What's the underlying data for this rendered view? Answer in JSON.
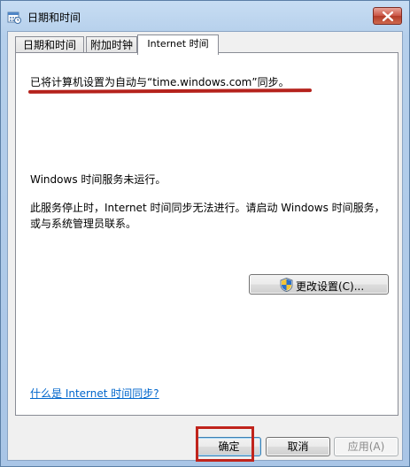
{
  "window": {
    "title": "日期和时间",
    "icon": "clock-calendar-icon",
    "close": "close-icon"
  },
  "tabs": [
    {
      "label": "日期和时间",
      "active": false
    },
    {
      "label": "附加时钟",
      "active": false
    },
    {
      "label": "Internet 时间",
      "active": true
    }
  ],
  "panel": {
    "sync_status": "已将计算机设置为自动与“time.windows.com”同步。",
    "service_status": "Windows 时间服务未运行。",
    "service_note_line1": "此服务停止时，Internet 时间同步无法进行。请启动 Windows 时间服务，",
    "service_note_line2": "或与系统管理员联系。",
    "change_settings_label": "更改设置(C)...",
    "help_link": "什么是 Internet 时间同步?"
  },
  "buttons": {
    "ok": "确定",
    "cancel": "取消",
    "apply": "应用(A)"
  },
  "annotation_color": "#c0241c"
}
